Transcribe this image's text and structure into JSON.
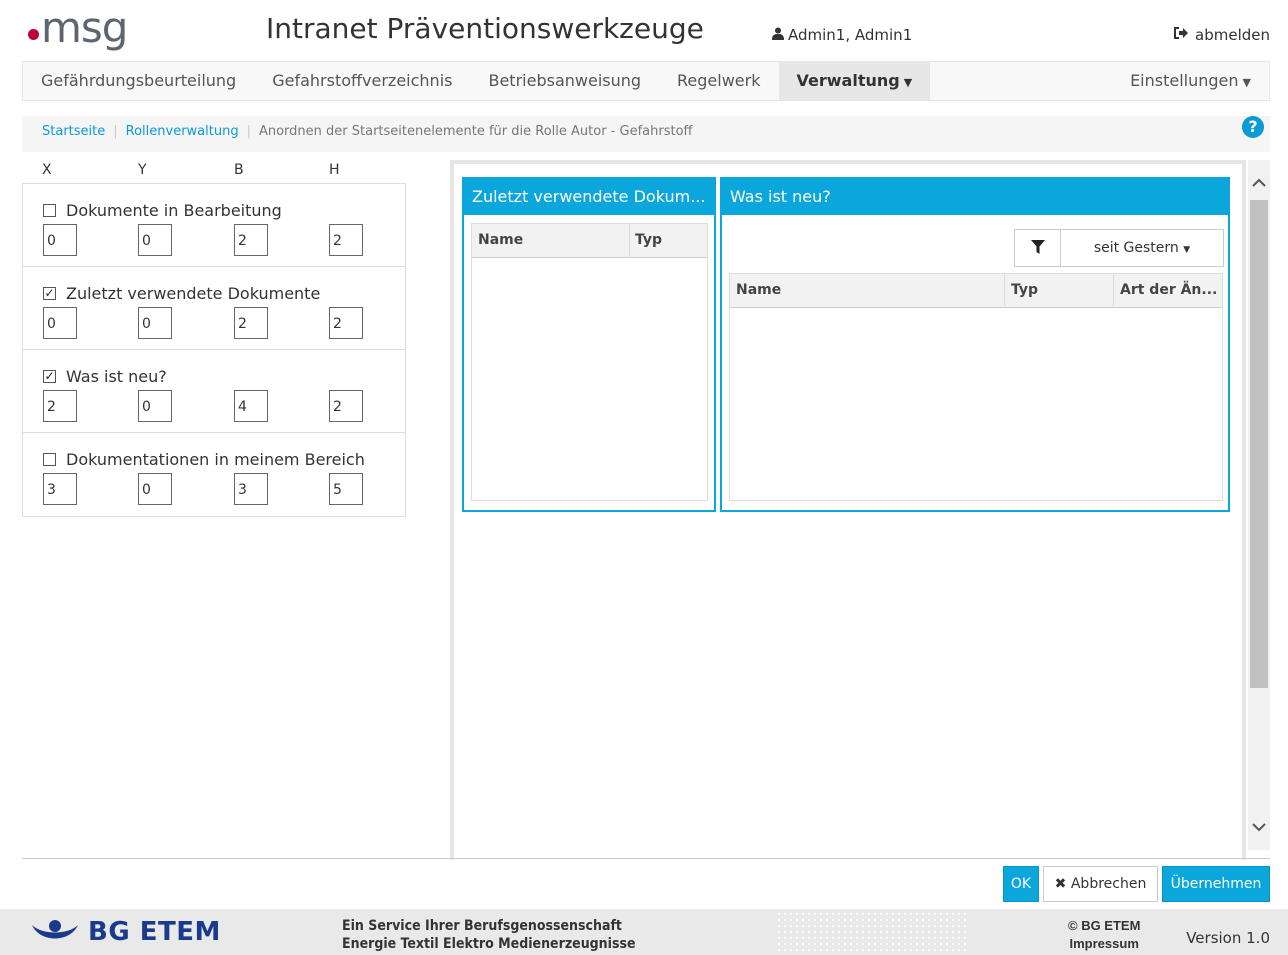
{
  "header": {
    "logo_text": "msg",
    "app_title": "Intranet Präventionswerkzeuge",
    "user": "Admin1, Admin1",
    "logout": "abmelden"
  },
  "nav": {
    "items": [
      {
        "label": "Gefährdungsbeurteilung"
      },
      {
        "label": "Gefahrstoffverzeichnis"
      },
      {
        "label": "Betriebsanweisung"
      },
      {
        "label": "Regelwerk"
      },
      {
        "label": "Verwaltung"
      }
    ],
    "right": "Einstellungen"
  },
  "breadcrumb": {
    "home": "Startseite",
    "roles": "Rollenverwaltung",
    "current": "Anordnen der Startseitenelemente für die Rolle Autor - Gefahrstoff"
  },
  "config": {
    "headers": {
      "x": "X",
      "y": "Y",
      "b": "B",
      "h": "H"
    },
    "items": [
      {
        "label": "Dokumente in Bearbeitung",
        "checked": false,
        "x": "0",
        "y": "0",
        "b": "2",
        "h": "2"
      },
      {
        "label": "Zuletzt verwendete Dokumente",
        "checked": true,
        "x": "0",
        "y": "0",
        "b": "2",
        "h": "2"
      },
      {
        "label": "Was ist neu?",
        "checked": true,
        "x": "2",
        "y": "0",
        "b": "4",
        "h": "2"
      },
      {
        "label": "Dokumentationen in meinem Bereich",
        "checked": false,
        "x": "3",
        "y": "0",
        "b": "3",
        "h": "5"
      }
    ]
  },
  "widgets": {
    "recent": {
      "title": "Zuletzt verwendete Dokum...",
      "col_name": "Name",
      "col_type": "Typ"
    },
    "news": {
      "title": "Was ist neu?",
      "filter": "seit Gestern",
      "col_name": "Name",
      "col_type": "Typ",
      "col_change": "Art der Än..."
    }
  },
  "buttons": {
    "ok": "OK",
    "cancel": "Abbrechen",
    "apply": "Übernehmen"
  },
  "footer": {
    "brand": "BG ETEM",
    "service_line1": "Ein Service Ihrer Berufsgenossenschaft",
    "service_line2": "Energie Textil Elektro Medienerzeugnisse",
    "copyright": "© BG ETEM",
    "impressum": "Impressum",
    "version": "Version 1.0"
  },
  "colors": {
    "accent": "#0aa6dc",
    "brand_dot": "#c0003c",
    "footer_brand": "#1a3a8c"
  }
}
